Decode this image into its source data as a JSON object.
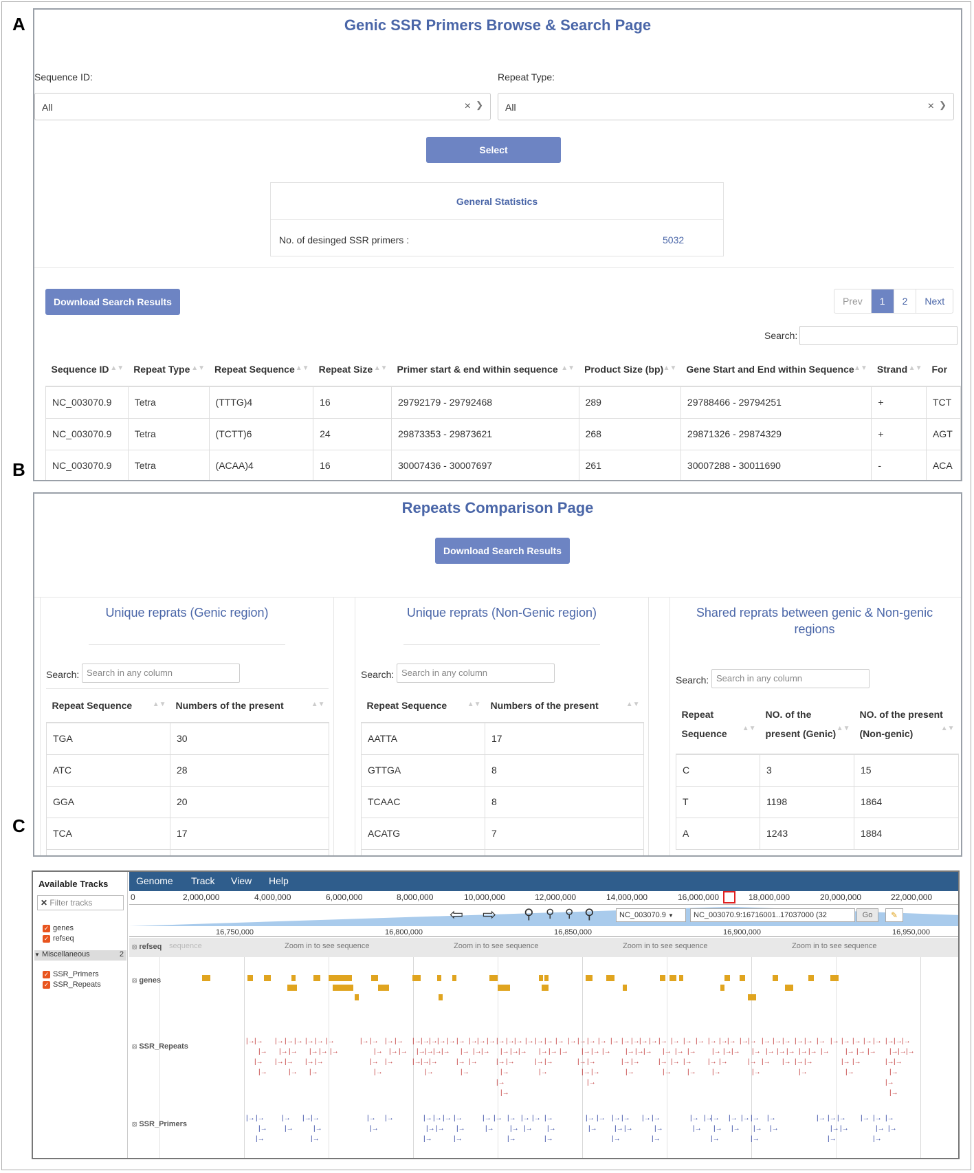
{
  "labels": {
    "a": "A",
    "b": "B",
    "c": "C"
  },
  "panel_a": {
    "title": "Genic SSR Primers Browse & Search Page",
    "sequence_id_label": "Sequence ID:",
    "sequence_id_value": "All",
    "repeat_type_label": "Repeat Type:",
    "repeat_type_value": "All",
    "select_button": "Select",
    "stats_title": "General Statistics",
    "stats_label": "No. of desinged SSR primers :",
    "stats_value": "5032",
    "download_button": "Download Search Results",
    "pagination": {
      "prev": "Prev",
      "pages": [
        "1",
        "2"
      ],
      "next": "Next"
    },
    "search_label": "Search:",
    "columns": [
      "Sequence ID",
      "Repeat Type",
      "Repeat Sequence",
      "Repeat Size",
      "Primer start & end within sequence",
      "Product Size (bp)",
      "Gene Start and End within Sequence",
      "Strand",
      "For"
    ],
    "rows": [
      [
        "NC_003070.9",
        "Tetra",
        "(TTTG)4",
        "16",
        "29792179 - 29792468",
        "289",
        "29788466 - 29794251",
        "+",
        "TCT"
      ],
      [
        "NC_003070.9",
        "Tetra",
        "(TCTT)6",
        "24",
        "29873353 - 29873621",
        "268",
        "29871326 - 29874329",
        "+",
        "AGT"
      ],
      [
        "NC_003070.9",
        "Tetra",
        "(ACAA)4",
        "16",
        "30007436 - 30007697",
        "261",
        "30007288 - 30011690",
        "-",
        "ACA"
      ]
    ]
  },
  "panel_b": {
    "title": "Repeats Comparison Page",
    "download_button": "Download Search Results",
    "search_label": "Search:",
    "search_placeholder": "Search in any column",
    "cards": [
      {
        "title": "Unique reprats (Genic region)",
        "columns": [
          "Repeat Sequence",
          "Numbers of the present"
        ],
        "rows": [
          [
            "TGA",
            "30"
          ],
          [
            "ATC",
            "28"
          ],
          [
            "GGA",
            "20"
          ],
          [
            "TCA",
            "17"
          ]
        ]
      },
      {
        "title": "Unique reprats (Non-Genic region)",
        "columns": [
          "Repeat Sequence",
          "Numbers of the present"
        ],
        "rows": [
          [
            "AATTA",
            "17"
          ],
          [
            "GTTGA",
            "8"
          ],
          [
            "TCAAC",
            "8"
          ],
          [
            "ACATG",
            "7"
          ]
        ]
      },
      {
        "title": "Shared reprats between genic & Non-genic regions",
        "columns": [
          "Repeat Sequence",
          "NO. of the present (Genic)",
          "NO. of the present (Non-genic)"
        ],
        "rows": [
          [
            "C",
            "3",
            "15"
          ],
          [
            "T",
            "1198",
            "1864"
          ],
          [
            "A",
            "1243",
            "1884"
          ]
        ]
      }
    ]
  },
  "panel_c": {
    "available_tracks": "Available Tracks",
    "filter_placeholder": "Filter tracks",
    "tracks_top": [
      "genes",
      "refseq"
    ],
    "misc_label": "Miscellaneous",
    "misc_count": "2",
    "tracks_misc": [
      "SSR_Primers",
      "SSR_Repeats"
    ],
    "menu": [
      "Genome",
      "Track",
      "View",
      "Help"
    ],
    "overview_ticks": [
      "0",
      "2,000,000",
      "4,000,000",
      "6,000,000",
      "8,000,000",
      "10,000,000",
      "12,000,000",
      "14,000,000",
      "16,000,000",
      "18,000,000",
      "20,000,000",
      "22,000,000"
    ],
    "ref_select": "NC_003070.9",
    "location": "NC_003070.9:16716001..17037000 (32",
    "go": "Go",
    "detail_ticks": [
      "16,750,000",
      "16,800,000",
      "16,850,000",
      "16,900,000",
      "16,950,000"
    ],
    "refseq_label": "refseq",
    "sequence_hint": "sequence",
    "zoom_hint": "Zoom in to see sequence",
    "genes_label": "genes",
    "ssr_repeats_label": "SSR_Repeats",
    "ssr_primers_label": "SSR_Primers",
    "colors": {
      "menu": "#2f5d8c",
      "gene": "#e0a41f",
      "repeat": "#c23b3b",
      "primer": "#2a3fa0"
    }
  }
}
